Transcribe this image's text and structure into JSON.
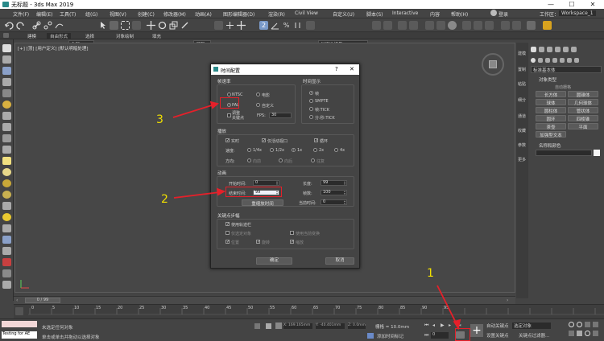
{
  "window": {
    "title": "无标题 - 3ds Max 2019",
    "minimize": "—",
    "maximize": "☐",
    "close": "✕"
  },
  "menubar": {
    "items": [
      "文件(F)",
      "编辑(E)",
      "工具(T)",
      "组(G)",
      "视图(V)",
      "创建(C)",
      "修改器(M)",
      "动画(A)",
      "图形编辑器(D)",
      "渲染(R)",
      "Civil View",
      "自定义(U)",
      "脚本(S)",
      "Interactive",
      "内容",
      "帮助(H)"
    ],
    "login_label": "登录",
    "workspace_label": "工作区：",
    "workspace_value": "Workspace_1"
  },
  "toolbar": {
    "selection_filter": "全部",
    "view_dropdown": "视图",
    "selection_set": "创建选择集"
  },
  "ribbon": {
    "tabs": [
      "建模",
      "自由形式",
      "选择",
      "对象绘制",
      "填充"
    ]
  },
  "viewport": {
    "label": "[+] [顶] [用户定义] [默认明暗处理]"
  },
  "dialog": {
    "title": "时间配置",
    "help": "?",
    "close": "✕",
    "frame_rate": {
      "title": "帧速率",
      "ntsc": "NTSC",
      "film": "电影",
      "pal": "PAL",
      "custom": "自定义",
      "fps_label": "FPS:",
      "fps_value": "30",
      "adjust_keys": "调整\n关键点"
    },
    "time_display": {
      "title": "时间显示",
      "frames": "帧",
      "smpte": "SMPTE",
      "frame_tick": "帧:TICK",
      "mmss_tick": "分:秒:TICK"
    },
    "playback": {
      "title": "播放",
      "realtime": "实时",
      "active_viewport": "仅活动视口",
      "loop": "循环",
      "speed_label": "速度:",
      "speeds": [
        "1/4x",
        "1/2x",
        "1x",
        "2x",
        "4x"
      ],
      "direction_label": "方向:",
      "directions": [
        "向前",
        "向后",
        "往复"
      ]
    },
    "animation": {
      "title": "动画",
      "start_label": "开始时间:",
      "start_value": "0",
      "end_label": "结束时间:",
      "end_value": "99",
      "length_label": "长度:",
      "length_value": "99",
      "count_label": "帧数:",
      "count_value": "100",
      "current_label": "当前时间:",
      "current_value": "0",
      "rescale": "重缩放时间"
    },
    "key_steps": {
      "title": "关键点步幅",
      "use_track": "使用轨迹栏",
      "selected_only": "仅选定对象",
      "current_transform": "使用当前变换",
      "position": "位置",
      "rotation": "旋转",
      "scale": "缩放"
    },
    "ok": "确定",
    "cancel": "取消"
  },
  "right_panel": {
    "tab_labels": [
      "建模",
      "置制",
      "粘贴",
      "细分",
      "通道",
      "收藏",
      "参数",
      "更多"
    ],
    "category": "标准基本体",
    "object_type_title": "对象类型",
    "autogrid": "自动栅格",
    "buttons": [
      "长方体",
      "圆锥体",
      "球体",
      "几何球体",
      "圆柱体",
      "管状体",
      "圆环",
      "四棱锥",
      "茶壶",
      "平面",
      "加强型文本"
    ],
    "name_color_title": "名称和颜色"
  },
  "timeline": {
    "slider_label": "0 / 99",
    "ticks": [
      "0",
      "5",
      "10",
      "15",
      "20",
      "25",
      "30",
      "35",
      "40",
      "45",
      "50",
      "55",
      "60",
      "65",
      "70",
      "75",
      "80",
      "85",
      "90",
      "95"
    ]
  },
  "statusbar": {
    "maxscript": "Testing for AE",
    "status1": "未选定任何对象",
    "status2": "单击或单击并拖动以选择对象",
    "x_value": "X: 169.165mm",
    "y_value": "Y: -40.401mm",
    "z_value": "Z: 0.0mm",
    "grid": "栅格 = 10.0mm",
    "add_time_tag": "添加时间标记",
    "frame_value": "0",
    "auto_key": "自动关键点",
    "set_key": "设置关键点",
    "selected_object": "选定对象",
    "key_filters": "关键点过滤器..."
  },
  "annotations": {
    "n1": "1",
    "n2": "2",
    "n3": "3",
    "arrow_color": "#e5202a",
    "number_color": "#f1e000"
  }
}
